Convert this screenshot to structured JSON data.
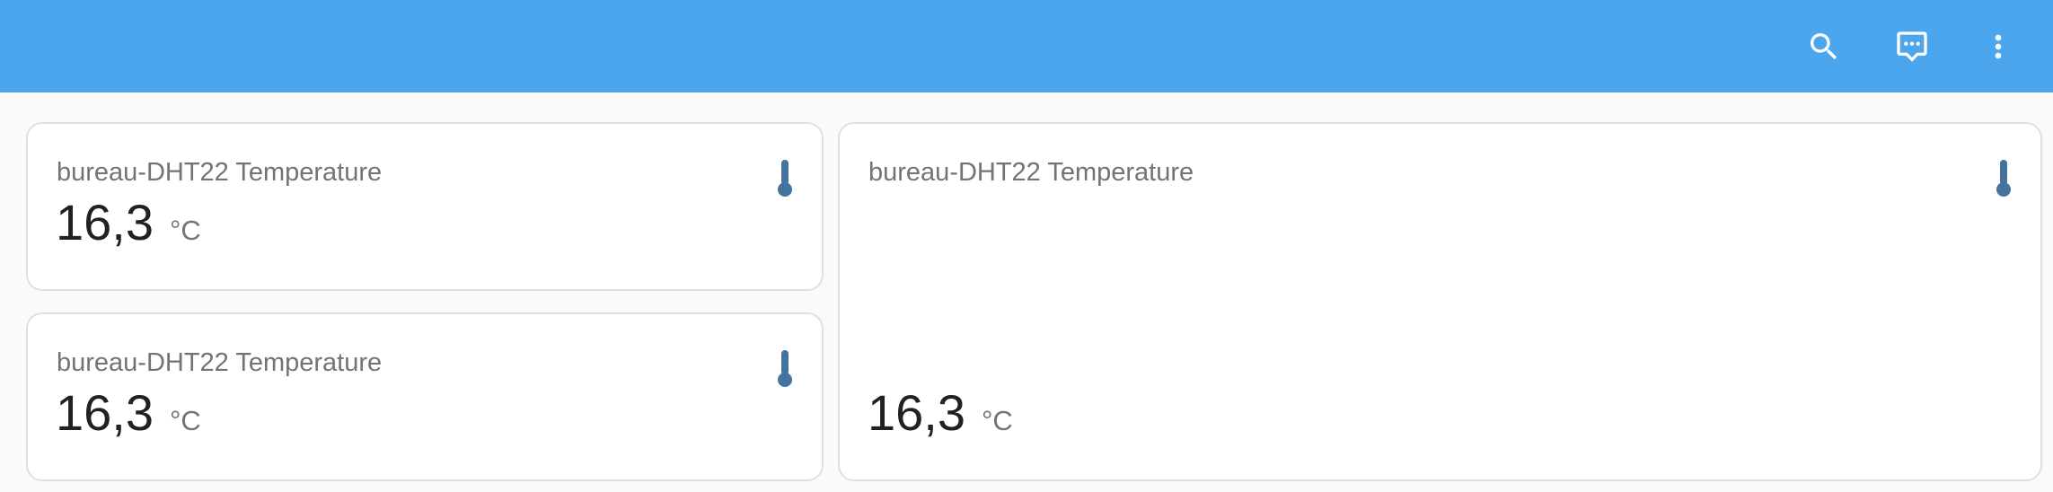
{
  "toolbar": {
    "background": "#4ba6ee",
    "actions": [
      {
        "icon": "search-icon"
      },
      {
        "icon": "assist-chat-icon"
      },
      {
        "icon": "more-vertical-icon"
      }
    ]
  },
  "cards": [
    {
      "name": "bureau-DHT22 Temperature",
      "state": "16,3",
      "unit": "°C",
      "icon": "thermometer-icon"
    },
    {
      "name": "bureau-DHT22 Temperature",
      "state": "16,3",
      "unit": "°C",
      "icon": "thermometer-icon"
    },
    {
      "name": "bureau-DHT22 Temperature",
      "state": "16,3",
      "unit": "°C",
      "icon": "thermometer-icon"
    }
  ],
  "colors": {
    "icon": "#44739e",
    "card_background": "#ffffff",
    "page_background": "#fafafa"
  }
}
